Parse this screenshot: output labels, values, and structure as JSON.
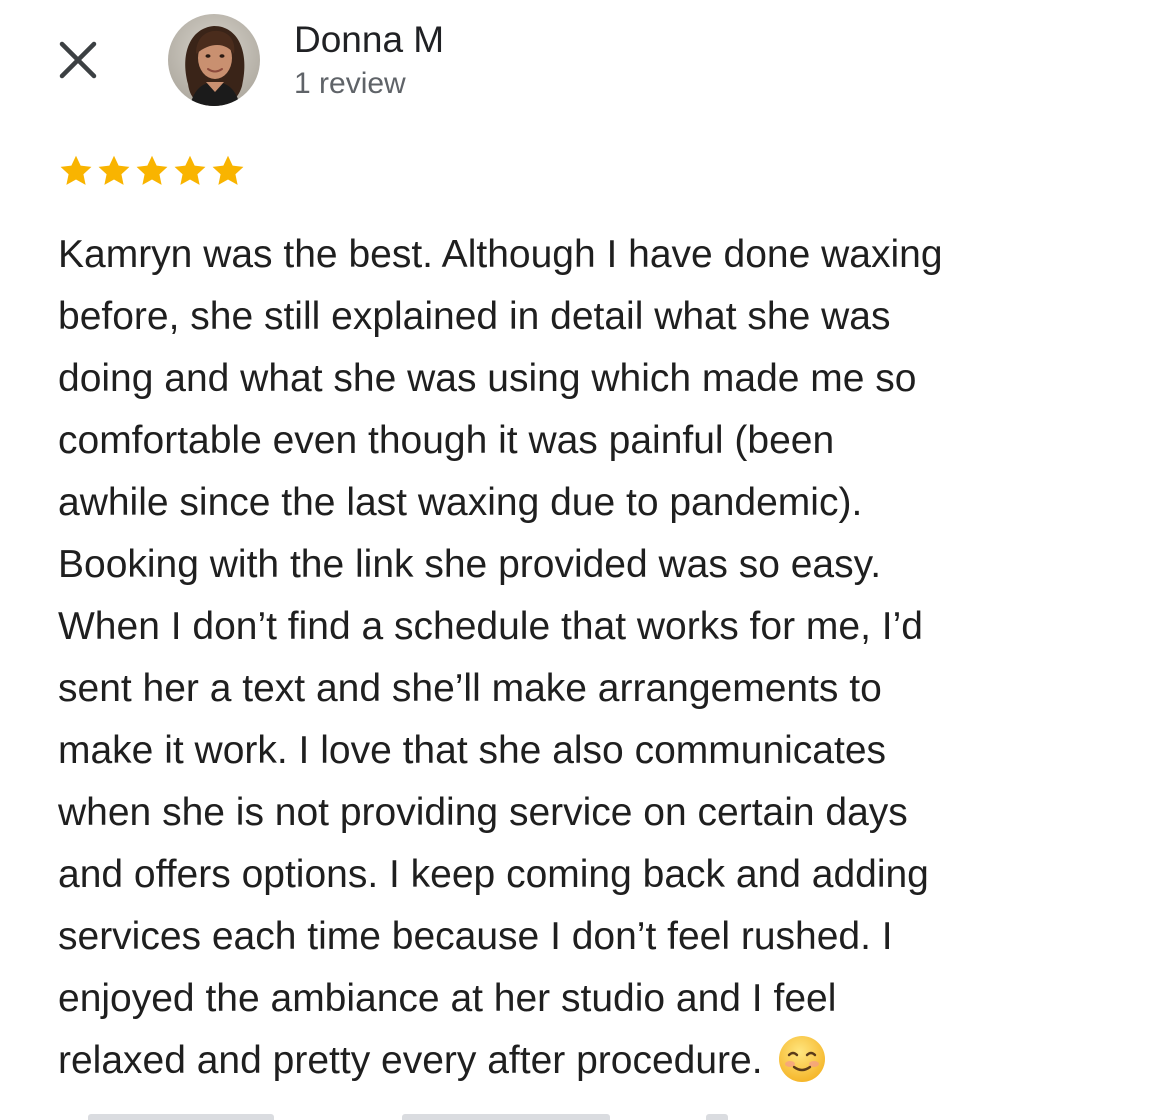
{
  "reviewer": {
    "name": "Donna M",
    "review_count": "1 review"
  },
  "rating": {
    "value": 5,
    "max": 5,
    "star_color": "#f9b400"
  },
  "review": {
    "lines": [
      "Kamryn was the best. Although I have done waxing",
      "before, she still explained in detail what she was",
      "doing and what she was using which made me so",
      "comfortable even though it was painful (been",
      "awhile since the last waxing due to pandemic).",
      "Booking with the link she provided was so easy.",
      "When I don’t find a schedule that works for me, I’d",
      "sent her a text and she’ll make arrangements to",
      "make it work. I love that she also communicates",
      "when she is not providing service on certain days",
      "and offers options. I keep coming back and adding",
      "services each time because I don’t feel rushed. I",
      "enjoyed the ambiance at her studio and I feel",
      "relaxed and pretty every after procedure."
    ],
    "end_emoji": "smiling-face-with-blush-emoji"
  },
  "icons": {
    "close": "close-icon",
    "star": "star-icon",
    "avatar": "profile-photo"
  }
}
